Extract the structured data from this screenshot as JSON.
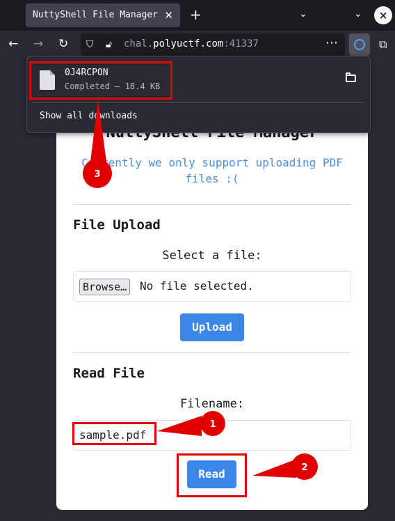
{
  "browser": {
    "tab_title": "NuttyShell File Manager",
    "tab_close": "✕",
    "new_tab": "+",
    "url_host_pre": "chal.",
    "url_host_main": "polyuctf.com",
    "url_port": ":41337",
    "url_more": "⋯"
  },
  "download": {
    "file_name": "0J4RCPON",
    "status": "Completed — 18.4 KB",
    "show_all": "Show all downloads"
  },
  "page": {
    "title": "NuttyShell File Manager",
    "notice": "Currently we only support uploading PDF files :(",
    "upload": {
      "section_title": "File Upload",
      "label": "Select a file:",
      "browse_label": "Browse…",
      "no_file": "No file selected.",
      "button": "Upload"
    },
    "read": {
      "section_title": "Read File",
      "label": "Filename:",
      "input_value": "sample.pdf",
      "button": "Read"
    }
  },
  "annotations": {
    "color": "#e00000",
    "labels": [
      "1",
      "2",
      "3"
    ]
  }
}
